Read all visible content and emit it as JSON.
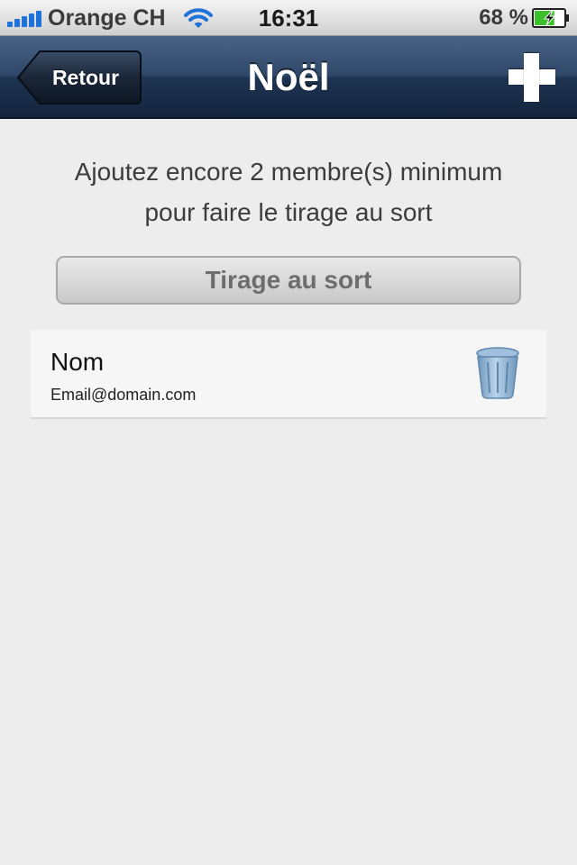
{
  "status_bar": {
    "carrier": "Orange CH",
    "time": "16:31",
    "battery_percent": "68 %",
    "signal_icon": "signal-bars-icon",
    "wifi_icon": "wifi-icon",
    "battery_icon": "battery-charging-icon",
    "battery_level": 0.68
  },
  "nav": {
    "back_label": "Retour",
    "title": "Noël",
    "add_icon": "plus-icon"
  },
  "content": {
    "info_line1": "Ajoutez encore 2 membre(s) minimum",
    "info_line2": "pour faire le tirage au sort",
    "draw_button_label": "Tirage au sort"
  },
  "members": [
    {
      "name": "Nom",
      "email": "Email@domain.com",
      "delete_icon": "trash-icon"
    }
  ],
  "colors": {
    "nav_bar": "#2f4869",
    "background": "#ededed",
    "signal": "#1f73d8",
    "battery_fill": "#3cc12c",
    "trash": "#8fb4d6"
  }
}
